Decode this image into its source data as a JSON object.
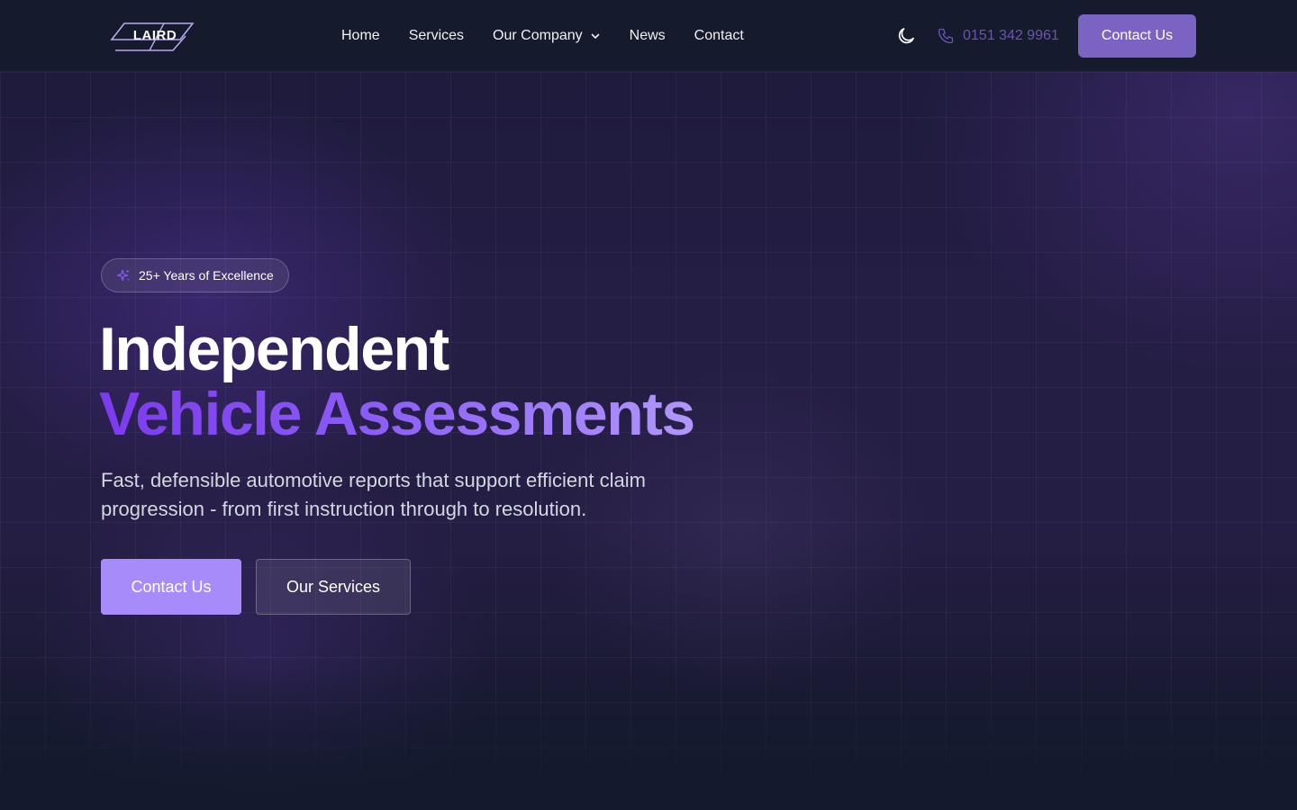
{
  "header": {
    "logo_text": "LAIRD",
    "nav": [
      {
        "label": "Home"
      },
      {
        "label": "Services"
      },
      {
        "label": "Our Company",
        "has_dropdown": true
      },
      {
        "label": "News"
      },
      {
        "label": "Contact"
      }
    ],
    "theme_toggle_icon": "moon-icon",
    "phone": "0151 342 9961",
    "cta_label": "Contact Us"
  },
  "hero": {
    "badge": "25+ Years of Excellence",
    "title_line1": "Independent",
    "title_line2": "Vehicle Assessments",
    "subtitle": "Fast, defensible automotive reports that support efficient claim progression - from first instruction through to resolution.",
    "primary_button": "Contact Us",
    "secondary_button": "Our Services"
  },
  "colors": {
    "accent": "#a78bfa",
    "header_cta": "#7b63c4",
    "phone": "#6a56b0",
    "background": "#141a2e"
  }
}
